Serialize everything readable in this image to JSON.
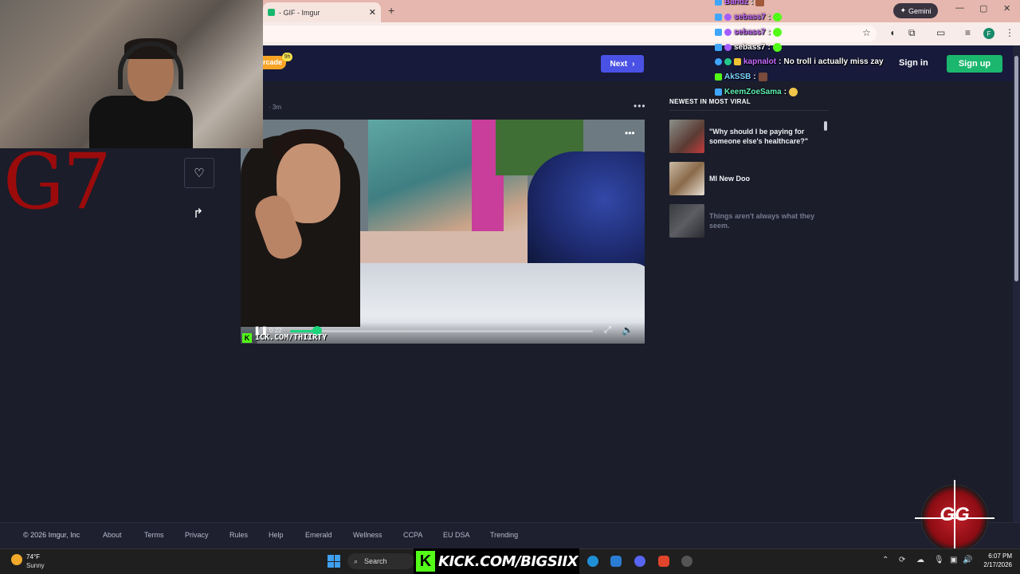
{
  "browser": {
    "tab_title": "- GIF - Imgur",
    "tab_close": "✕",
    "new_tab": "+",
    "gemini_label": "Gemini",
    "window_min": "—",
    "window_max": "▢",
    "window_close": "✕",
    "profile_initial": "F"
  },
  "imgur": {
    "arcade_label": "rcade",
    "arcade_badge": "9h",
    "next_label": "Next",
    "next_chevron": "›",
    "sign_in": "Sign in",
    "sign_up": "Sign up",
    "post_time": "· 3m",
    "post_menu": "•••",
    "like_icon": "♡",
    "share_icon": "↱",
    "video": {
      "time": "0:22",
      "progress": 0.09,
      "watermark": "ICK.COM/THIIRTY",
      "menu": "•••",
      "play_icon": "❚❚",
      "fullscreen_icon": "⤢",
      "volume_icon": "🔈"
    },
    "sidebar": {
      "heading": "NEWEST IN MOST VIRAL",
      "items": [
        {
          "title": "\"Why should I be paying for someone else's healthcare?\"",
          "dim": false
        },
        {
          "title": "MI New Doo",
          "dim": false
        },
        {
          "title": "Things aren't always what they seem.",
          "dim": true
        }
      ]
    }
  },
  "overlay": {
    "g7_text": "G7",
    "chat": [
      {
        "user": "Bandz",
        "message": "",
        "user_color": "#c86bff"
      },
      {
        "user": "sebass7",
        "message": "",
        "user_color": "#c86bff"
      },
      {
        "user": "sebass7",
        "message": "",
        "user_color": "#c86bff"
      },
      {
        "user": "sebass7",
        "message": "",
        "user_color": "#ffffff"
      },
      {
        "user": "kapnalot",
        "message": "No troll i actually miss zay",
        "user_color": "#c86bff"
      },
      {
        "user": "AkSSB",
        "message": "",
        "user_color": "#7dd3ff"
      },
      {
        "user": "KeemZoeSama",
        "message": "",
        "user_color": "#5ef0b3"
      }
    ]
  },
  "footer": {
    "links": [
      "© 2026 Imgur, Inc",
      "About",
      "Terms",
      "Privacy",
      "Rules",
      "Help",
      "Emerald",
      "Wellness",
      "CCPA",
      "EU DSA",
      "Trending"
    ]
  },
  "taskbar": {
    "temp": "74°F",
    "condition": "Sunny",
    "search": "Search",
    "kick_text": "KICK.COM/BIGSIIX",
    "kick_k": "K",
    "time": "6:07 PM",
    "date": "2/17/2026"
  },
  "colors": {
    "imgur_green": "#1bb76e",
    "next_blue": "#4a52e6",
    "kick_green": "#53fc18",
    "g7_red": "#9b0b0b"
  }
}
